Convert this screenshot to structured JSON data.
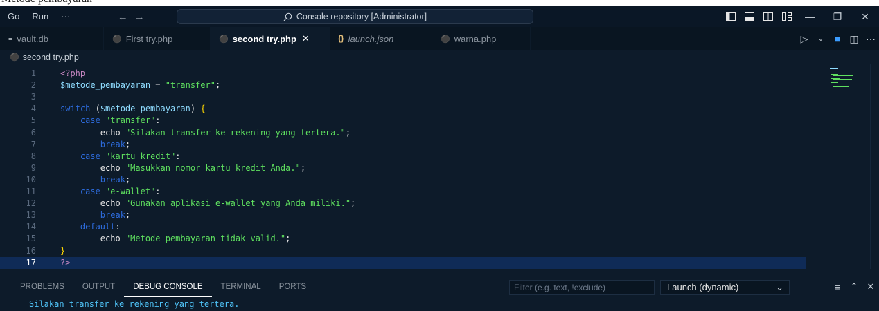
{
  "doc_caption": "Metode pembayaran",
  "titlebar": {
    "menus": [
      "Go",
      "Run",
      "···"
    ],
    "search_text": "Console repository [Administrator]"
  },
  "tabs": [
    {
      "label": "vault.db",
      "icon": "list-icon",
      "active": false,
      "italic": false
    },
    {
      "label": "First try.php",
      "icon": "php-icon",
      "active": false,
      "italic": false
    },
    {
      "label": "second try.php",
      "icon": "php-icon",
      "active": true,
      "italic": false
    },
    {
      "label": "launch.json",
      "icon": "json-icon",
      "active": false,
      "italic": true
    },
    {
      "label": "warna.php",
      "icon": "php-icon",
      "active": false,
      "italic": false
    }
  ],
  "tab_close_glyph": "✕",
  "breadcrumb": {
    "file": "second try.php"
  },
  "editor": {
    "current_line": 17,
    "lines": [
      {
        "n": "1",
        "code": "<?php"
      },
      {
        "n": "2",
        "code": "$metode_pembayaran = \"transfer\";"
      },
      {
        "n": "3",
        "code": ""
      },
      {
        "n": "4",
        "code": "switch ($metode_pembayaran) {"
      },
      {
        "n": "5",
        "code": "    case \"transfer\":"
      },
      {
        "n": "6",
        "code": "        echo \"Silakan transfer ke rekening yang tertera.\";"
      },
      {
        "n": "7",
        "code": "        break;"
      },
      {
        "n": "8",
        "code": "    case \"kartu kredit\":"
      },
      {
        "n": "9",
        "code": "        echo \"Masukkan nomor kartu kredit Anda.\";"
      },
      {
        "n": "10",
        "code": "        break;"
      },
      {
        "n": "11",
        "code": "    case \"e-wallet\":"
      },
      {
        "n": "12",
        "code": "        echo \"Gunakan aplikasi e-wallet yang Anda miliki.\";"
      },
      {
        "n": "13",
        "code": "        break;"
      },
      {
        "n": "14",
        "code": "    default:"
      },
      {
        "n": "15",
        "code": "        echo \"Metode pembayaran tidak valid.\";"
      },
      {
        "n": "16",
        "code": "}"
      },
      {
        "n": "17",
        "code": "?>"
      }
    ]
  },
  "panel": {
    "tabs": [
      "PROBLEMS",
      "OUTPUT",
      "DEBUG CONSOLE",
      "TERMINAL",
      "PORTS"
    ],
    "active_tab": "DEBUG CONSOLE",
    "filter_placeholder": "Filter (e.g. text, !exclude)",
    "launch_config": "Launch (dynamic)",
    "output": "Silakan transfer ke rekening yang tertera."
  },
  "colors": {
    "background": "#0d1b2a",
    "current_line": "#0f2b57",
    "string": "#5fe05f",
    "variable": "#8fdcff",
    "keyword": "#2d6bdb"
  }
}
